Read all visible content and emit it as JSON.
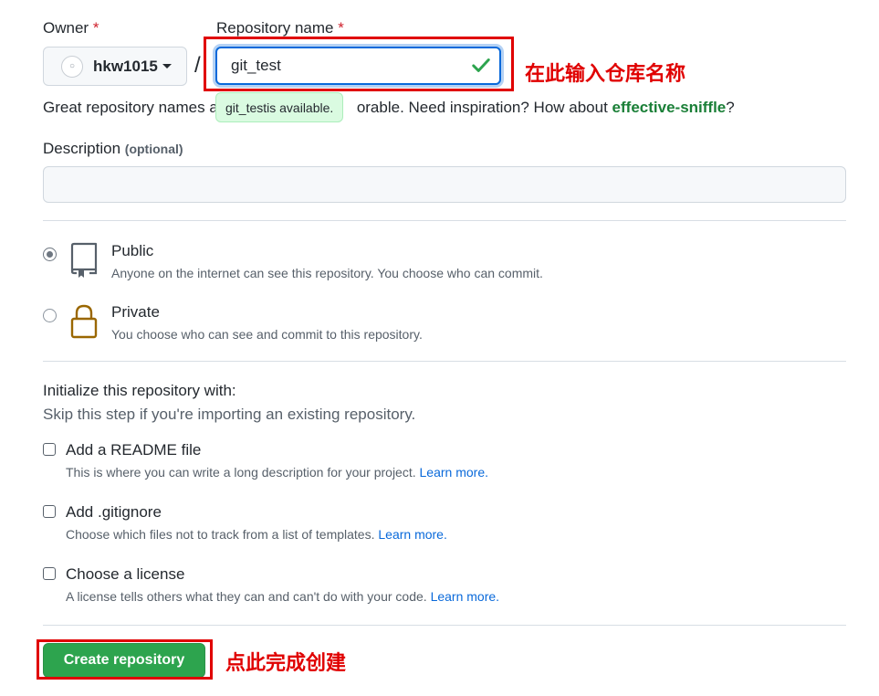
{
  "owner": {
    "label": "Owner",
    "required_mark": "*",
    "value": "hkw1015"
  },
  "repo_name": {
    "label": "Repository name",
    "required_mark": "*",
    "value": "git_test",
    "available_name": "git_test",
    "available_text": " is available."
  },
  "separator": "/",
  "annotation_top": "在此输入仓库名称",
  "annotation_bottom": "点此完成创建",
  "hint": {
    "text_before": "Great repository names a",
    "text_after": "orable. Need inspiration? How about ",
    "suggestion": "effective-sniffle",
    "end": "?"
  },
  "description": {
    "label": "Description",
    "optional": "(optional)",
    "value": ""
  },
  "visibility": [
    {
      "title": "Public",
      "desc": "Anyone on the internet can see this repository. You choose who can commit.",
      "selected": true
    },
    {
      "title": "Private",
      "desc": "You choose who can see and commit to this repository.",
      "selected": false
    }
  ],
  "init": {
    "title": "Initialize this repository with:",
    "subtitle": "Skip this step if you're importing an existing repository.",
    "options": [
      {
        "title": "Add a README file",
        "desc": "This is where you can write a long description for your project. ",
        "link": "Learn more."
      },
      {
        "title": "Add .gitignore",
        "desc": "Choose which files not to track from a list of templates. ",
        "link": "Learn more."
      },
      {
        "title": "Choose a license",
        "desc": "A license tells others what they can and can't do with your code. ",
        "link": "Learn more."
      }
    ]
  },
  "create_button": "Create repository",
  "colors": {
    "accent_blue": "#0969da",
    "success_green": "#2da44e",
    "annotation_red": "#e00000"
  }
}
